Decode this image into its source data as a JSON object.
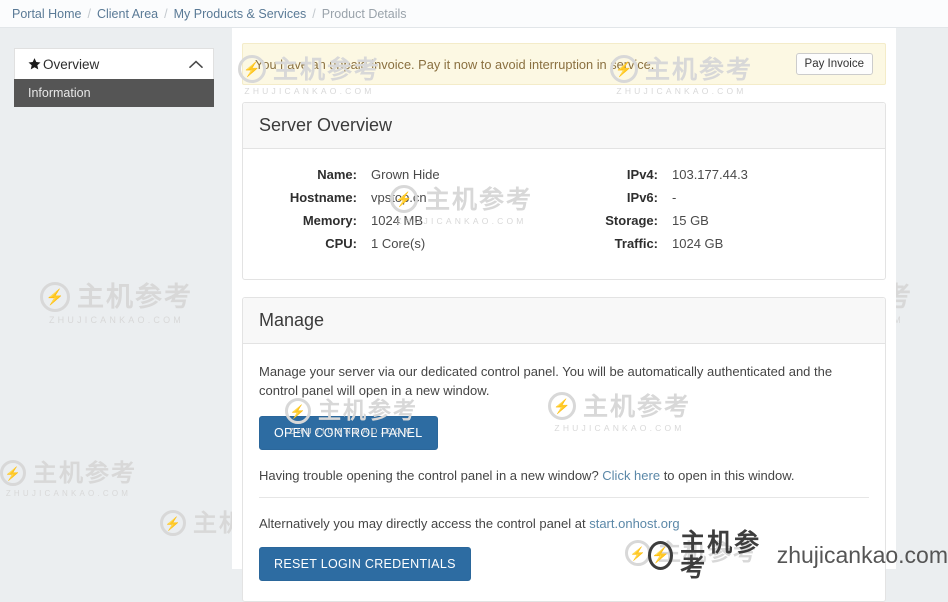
{
  "breadcrumb": {
    "separator": "/",
    "items": [
      {
        "label": "Portal Home",
        "current": false
      },
      {
        "label": "Client Area",
        "current": false
      },
      {
        "label": "My Products & Services",
        "current": false
      },
      {
        "label": "Product Details",
        "current": true
      }
    ]
  },
  "sidebar": {
    "title": "Overview",
    "star_icon": "star-icon",
    "collapse_icon": "chevron-up-icon",
    "items": [
      {
        "label": "Information",
        "active": true
      }
    ]
  },
  "alert": {
    "message": "You have an unpaid invoice. Pay it now to avoid interruption in service.",
    "button_label": "Pay Invoice",
    "background": "#fcf8e3",
    "text_color": "#8a7040"
  },
  "server_overview": {
    "heading": "Server Overview",
    "left_specs": [
      {
        "label": "Name:",
        "value": "Grown Hide"
      },
      {
        "label": "Hostname:",
        "value": "vpstop.cn"
      },
      {
        "label": "Memory:",
        "value": "1024 MB"
      },
      {
        "label": "CPU:",
        "value": "1 Core(s)"
      }
    ],
    "right_specs": [
      {
        "label": "IPv4:",
        "value": "103.177.44.3"
      },
      {
        "label": "IPv6:",
        "value": "-"
      },
      {
        "label": "Storage:",
        "value": "15 GB"
      },
      {
        "label": "Traffic:",
        "value": "1024 GB"
      }
    ]
  },
  "manage": {
    "heading": "Manage",
    "description": "Manage your server via our dedicated control panel. You will be automatically authenticated and the control panel will open in a new window.",
    "open_panel_button": "OPEN CONTROL PANEL",
    "trouble_prefix": "Having trouble opening the control panel in a new window? ",
    "trouble_link": "Click here",
    "trouble_suffix": " to open in this window.",
    "alt_prefix": "Alternatively you may directly access the control panel at ",
    "alt_link": "start.onhost.org",
    "reset_button": "RESET LOGIN CREDENTIALS",
    "accent_color": "#2d6ca2"
  },
  "watermark": {
    "cn_text": "主机参考",
    "domain_caps": "ZHUJICANKAO.COM",
    "domain_lower": "zhujicankao.com",
    "bolt": "⚡"
  }
}
